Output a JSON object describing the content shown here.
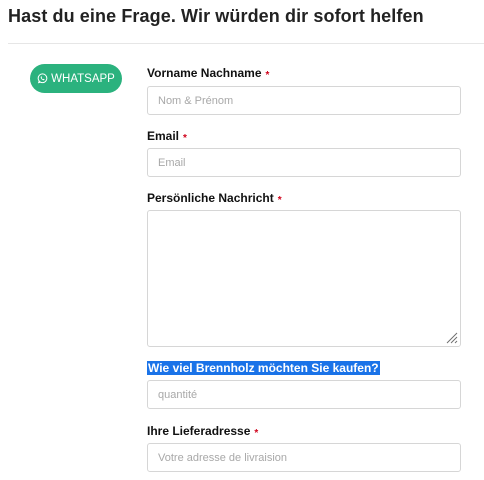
{
  "page": {
    "heading": "Hast du eine Frage. Wir würden dir sofort helfen"
  },
  "whatsapp": {
    "label": "WHATSAPP",
    "icon": "whatsapp-icon",
    "color": "#2bb27e"
  },
  "form": {
    "required_marker": "*",
    "required_color": "#d0021b",
    "fields": {
      "name": {
        "label": "Vorname Nachname",
        "placeholder": "Nom & Prénom",
        "value": "",
        "required": true
      },
      "email": {
        "label": "Email",
        "placeholder": "Email",
        "value": "",
        "required": true
      },
      "message": {
        "label": "Persönliche Nachricht",
        "value": "",
        "required": true
      },
      "quantity": {
        "label": "Wie viel Brennholz möchten Sie kaufen?",
        "placeholder": "quantité",
        "value": "",
        "required": false,
        "label_selected": true
      },
      "address": {
        "label": "Ihre Lieferadresse",
        "placeholder": "Votre adresse de livraision",
        "value": "",
        "required": true
      }
    }
  }
}
